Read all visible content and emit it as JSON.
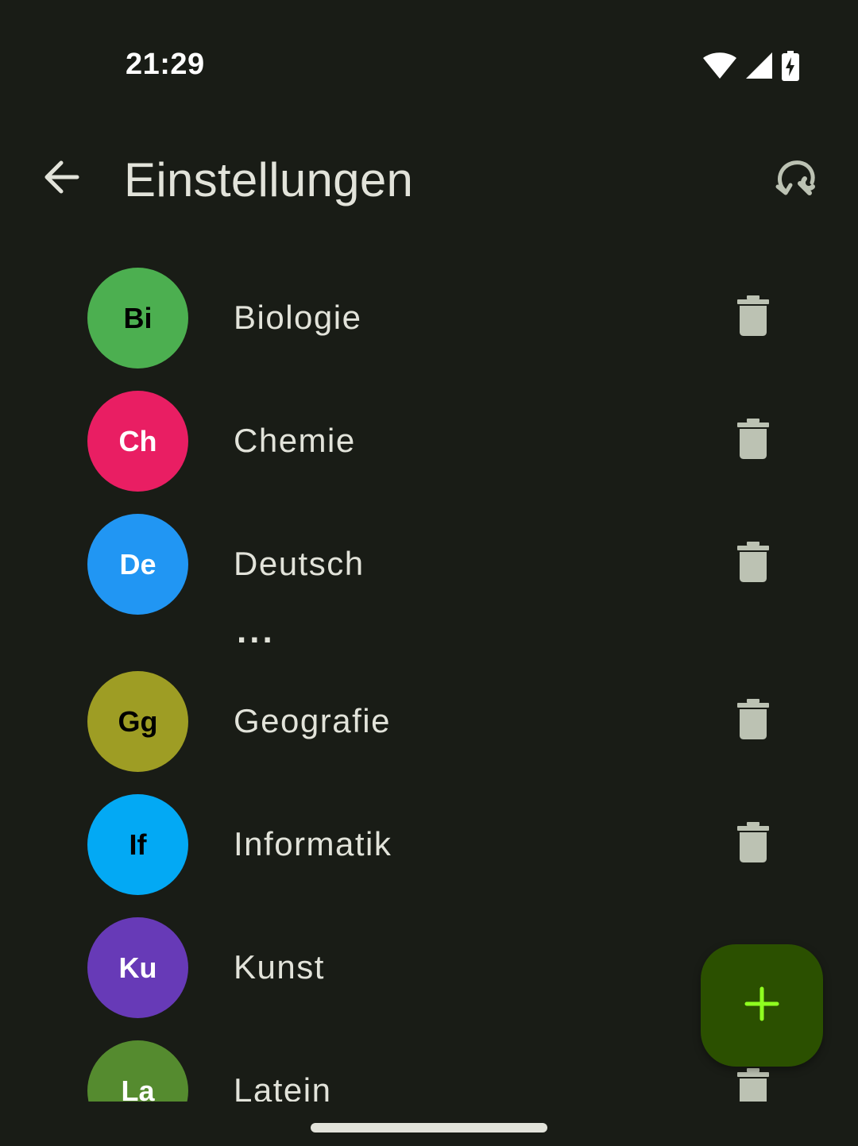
{
  "status_bar": {
    "time": "21:29",
    "icons": [
      "wifi-icon",
      "signal-icon",
      "battery-charging-icon"
    ]
  },
  "app_bar": {
    "back_icon": "arrow-back-icon",
    "title": "Einstellungen",
    "action_icon": "restore-settings-icon"
  },
  "colors": {
    "background": "#191c16",
    "on_surface": "#e2e3da",
    "icon_muted": "#bcc2b3",
    "fab_background": "#2b5000",
    "fab_icon": "#8fff1f"
  },
  "subjects": [
    {
      "abbr": "Bi",
      "name": "Biologie",
      "color": "#4caf50",
      "text_color": "#000000"
    },
    {
      "abbr": "Ch",
      "name": "Chemie",
      "color": "#e91e63",
      "text_color": "#ffffff"
    },
    {
      "abbr": "De",
      "name": "Deutsch",
      "color": "#2196f3",
      "text_color": "#ffffff"
    },
    {
      "abbr": "Gg",
      "name": "Geografie",
      "color": "#9e9d24",
      "text_color": "#000000"
    },
    {
      "abbr": "If",
      "name": "Informatik",
      "color": "#03a9f4",
      "text_color": "#000000"
    },
    {
      "abbr": "Ku",
      "name": "Kunst",
      "color": "#673ab7",
      "text_color": "#ffffff"
    },
    {
      "abbr": "La",
      "name": "Latein",
      "color": "#558b2f",
      "text_color": "#ffffff"
    }
  ],
  "ellipsis": "...",
  "fab": {
    "icon": "add-icon"
  }
}
